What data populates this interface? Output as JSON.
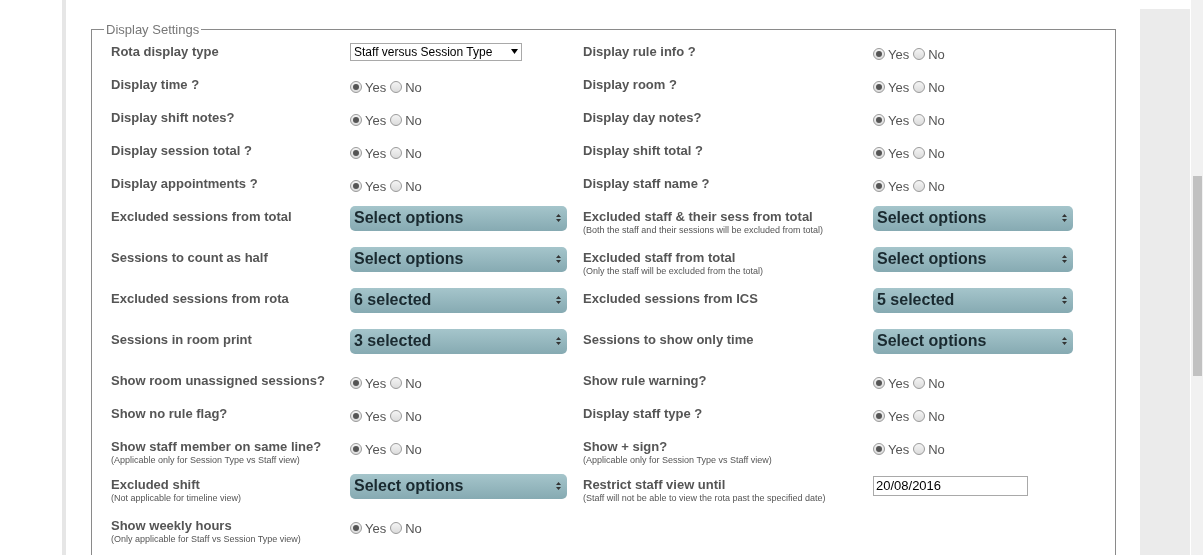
{
  "fieldset": {
    "legend": "Display Settings"
  },
  "rows": [
    {
      "left": {
        "kind": "select",
        "label": "Rota display type",
        "value": "Staff versus Session Type"
      },
      "right": {
        "kind": "radio",
        "label": "Display rule info ?",
        "options": [
          {
            "label": "Yes",
            "selected": true
          },
          {
            "label": "No",
            "selected": false
          }
        ]
      }
    },
    {
      "left": {
        "kind": "radio",
        "label": "Display time ?",
        "options": [
          {
            "label": "Yes",
            "selected": true
          },
          {
            "label": "No",
            "selected": false
          }
        ]
      },
      "right": {
        "kind": "radio",
        "label": "Display room ?",
        "options": [
          {
            "label": "Yes",
            "selected": true
          },
          {
            "label": "No",
            "selected": false
          }
        ]
      }
    },
    {
      "left": {
        "kind": "radio",
        "label": "Display shift notes?",
        "options": [
          {
            "label": "Yes",
            "selected": true
          },
          {
            "label": "No",
            "selected": false
          }
        ]
      },
      "right": {
        "kind": "radio",
        "label": "Display day notes?",
        "options": [
          {
            "label": "Yes",
            "selected": true
          },
          {
            "label": "No",
            "selected": false
          }
        ]
      }
    },
    {
      "left": {
        "kind": "radio",
        "label": "Display session total ?",
        "options": [
          {
            "label": "Yes",
            "selected": true
          },
          {
            "label": "No",
            "selected": false
          }
        ]
      },
      "right": {
        "kind": "radio",
        "label": "Display shift total ?",
        "options": [
          {
            "label": "Yes",
            "selected": true
          },
          {
            "label": "No",
            "selected": false
          }
        ]
      }
    },
    {
      "left": {
        "kind": "radio",
        "label": "Display appointments ?",
        "options": [
          {
            "label": "Yes",
            "selected": true
          },
          {
            "label": "No",
            "selected": false
          }
        ]
      },
      "right": {
        "kind": "radio",
        "label": "Display staff name ?",
        "options": [
          {
            "label": "Yes",
            "selected": true
          },
          {
            "label": "No",
            "selected": false
          }
        ]
      }
    },
    {
      "left": {
        "kind": "multiselect",
        "label": "Excluded sessions from total",
        "value": "Select options"
      },
      "right": {
        "kind": "multiselect",
        "label": "Excluded staff & their sess from total",
        "note": "(Both the staff and their sessions will be excluded from total)",
        "value": "Select options"
      }
    },
    {
      "left": {
        "kind": "multiselect",
        "label": "Sessions to count as half",
        "value": "Select options"
      },
      "right": {
        "kind": "multiselect",
        "label": "Excluded staff from total",
        "note": "(Only the staff will be excluded from the total)",
        "value": "Select options"
      }
    },
    {
      "left": {
        "kind": "multiselect",
        "label": "Excluded sessions from rota",
        "value": "6 selected"
      },
      "right": {
        "kind": "multiselect",
        "label": "Excluded sessions from ICS",
        "value": "5 selected"
      }
    },
    {
      "left": {
        "kind": "multiselect",
        "label": "Sessions in room print",
        "value": "3 selected"
      },
      "right": {
        "kind": "multiselect",
        "label": "Sessions to show only time",
        "value": "Select options"
      }
    },
    {
      "left": {
        "kind": "radio",
        "label": "Show room unassigned sessions?",
        "options": [
          {
            "label": "Yes",
            "selected": true
          },
          {
            "label": "No",
            "selected": false
          }
        ]
      },
      "right": {
        "kind": "radio",
        "label": "Show rule warning?",
        "options": [
          {
            "label": "Yes",
            "selected": true
          },
          {
            "label": "No",
            "selected": false
          }
        ]
      }
    },
    {
      "left": {
        "kind": "radio",
        "label": "Show no rule flag?",
        "options": [
          {
            "label": "Yes",
            "selected": true
          },
          {
            "label": "No",
            "selected": false
          }
        ]
      },
      "right": {
        "kind": "radio",
        "label": "Display staff type ?",
        "options": [
          {
            "label": "Yes",
            "selected": true
          },
          {
            "label": "No",
            "selected": false
          }
        ]
      }
    },
    {
      "left": {
        "kind": "radio",
        "label": "Show staff member on same line?",
        "note": "(Applicable only for Session Type vs Staff view)",
        "options": [
          {
            "label": "Yes",
            "selected": true
          },
          {
            "label": "No",
            "selected": false
          }
        ]
      },
      "right": {
        "kind": "radio",
        "label": "Show + sign?",
        "note": "(Applicable only for Session Type vs Staff view)",
        "options": [
          {
            "label": "Yes",
            "selected": true
          },
          {
            "label": "No",
            "selected": false
          }
        ]
      }
    },
    {
      "left": {
        "kind": "multiselect",
        "label": "Excluded shift",
        "note": "(Not applicable for timeline view)",
        "value": "Select options"
      },
      "right": {
        "kind": "text",
        "label": "Restrict staff view until",
        "note": "(Staff will not be able to view the rota past the specified date)",
        "value": "20/08/2016"
      }
    },
    {
      "left": {
        "kind": "radio",
        "label": "Show weekly hours",
        "note": "(Only applicable for Staff vs Session Type view)",
        "options": [
          {
            "label": "Yes",
            "selected": true
          },
          {
            "label": "No",
            "selected": false
          }
        ]
      }
    }
  ]
}
